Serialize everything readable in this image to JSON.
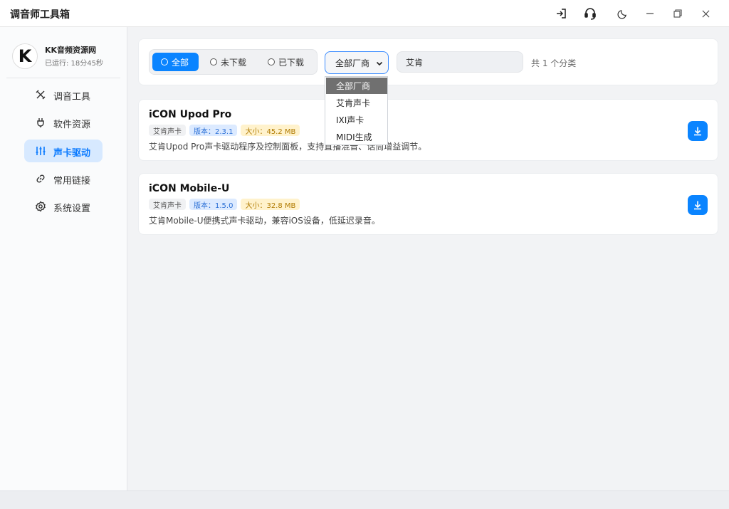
{
  "app": {
    "title": "调音师工具箱"
  },
  "titlebar": {
    "icons": [
      "logout-icon",
      "headset-icon",
      "moon-icon",
      "minimize-icon",
      "restore-icon",
      "close-icon"
    ]
  },
  "sidebar": {
    "avatar_letter": "K",
    "site_name": "KK音频资源网",
    "runtime": "已运行: 18分45秒",
    "items": [
      {
        "label": "调音工具",
        "icon": "tools-icon",
        "active": false
      },
      {
        "label": "软件资源",
        "icon": "plug-icon",
        "active": false
      },
      {
        "label": "声卡驱动",
        "icon": "sliders-icon",
        "active": true
      },
      {
        "label": "常用链接",
        "icon": "link-icon",
        "active": false
      },
      {
        "label": "系统设置",
        "icon": "gear-icon",
        "active": false
      }
    ]
  },
  "filter": {
    "segments": [
      {
        "label": "全部",
        "active": true
      },
      {
        "label": "未下载",
        "active": false
      },
      {
        "label": "已下载",
        "active": false
      }
    ],
    "vendor_selected": "全部厂商",
    "search_value": "艾肯",
    "count_text": "共 1 个分类",
    "dropdown_options": [
      "全部厂商",
      "艾肯声卡",
      "IXI声卡",
      "MIDI生成"
    ]
  },
  "drivers": [
    {
      "title": "iCON Upod Pro",
      "vendor_tag": "艾肯声卡",
      "version_tag": "版本：2.3.1",
      "size_tag": "大小：45.2 MB",
      "description": "艾肯Upod Pro声卡驱动程序及控制面板，支持直播混音、话筒增益调节。"
    },
    {
      "title": "iCON Mobile-U",
      "vendor_tag": "艾肯声卡",
      "version_tag": "版本：1.5.0",
      "size_tag": "大小：32.8 MB",
      "description": "艾肯Mobile-U便携式声卡驱动，兼容iOS设备，低延迟录音。"
    }
  ],
  "colors": {
    "accent": "#0a84ff",
    "nav_active_bg": "#d7e9ff"
  }
}
